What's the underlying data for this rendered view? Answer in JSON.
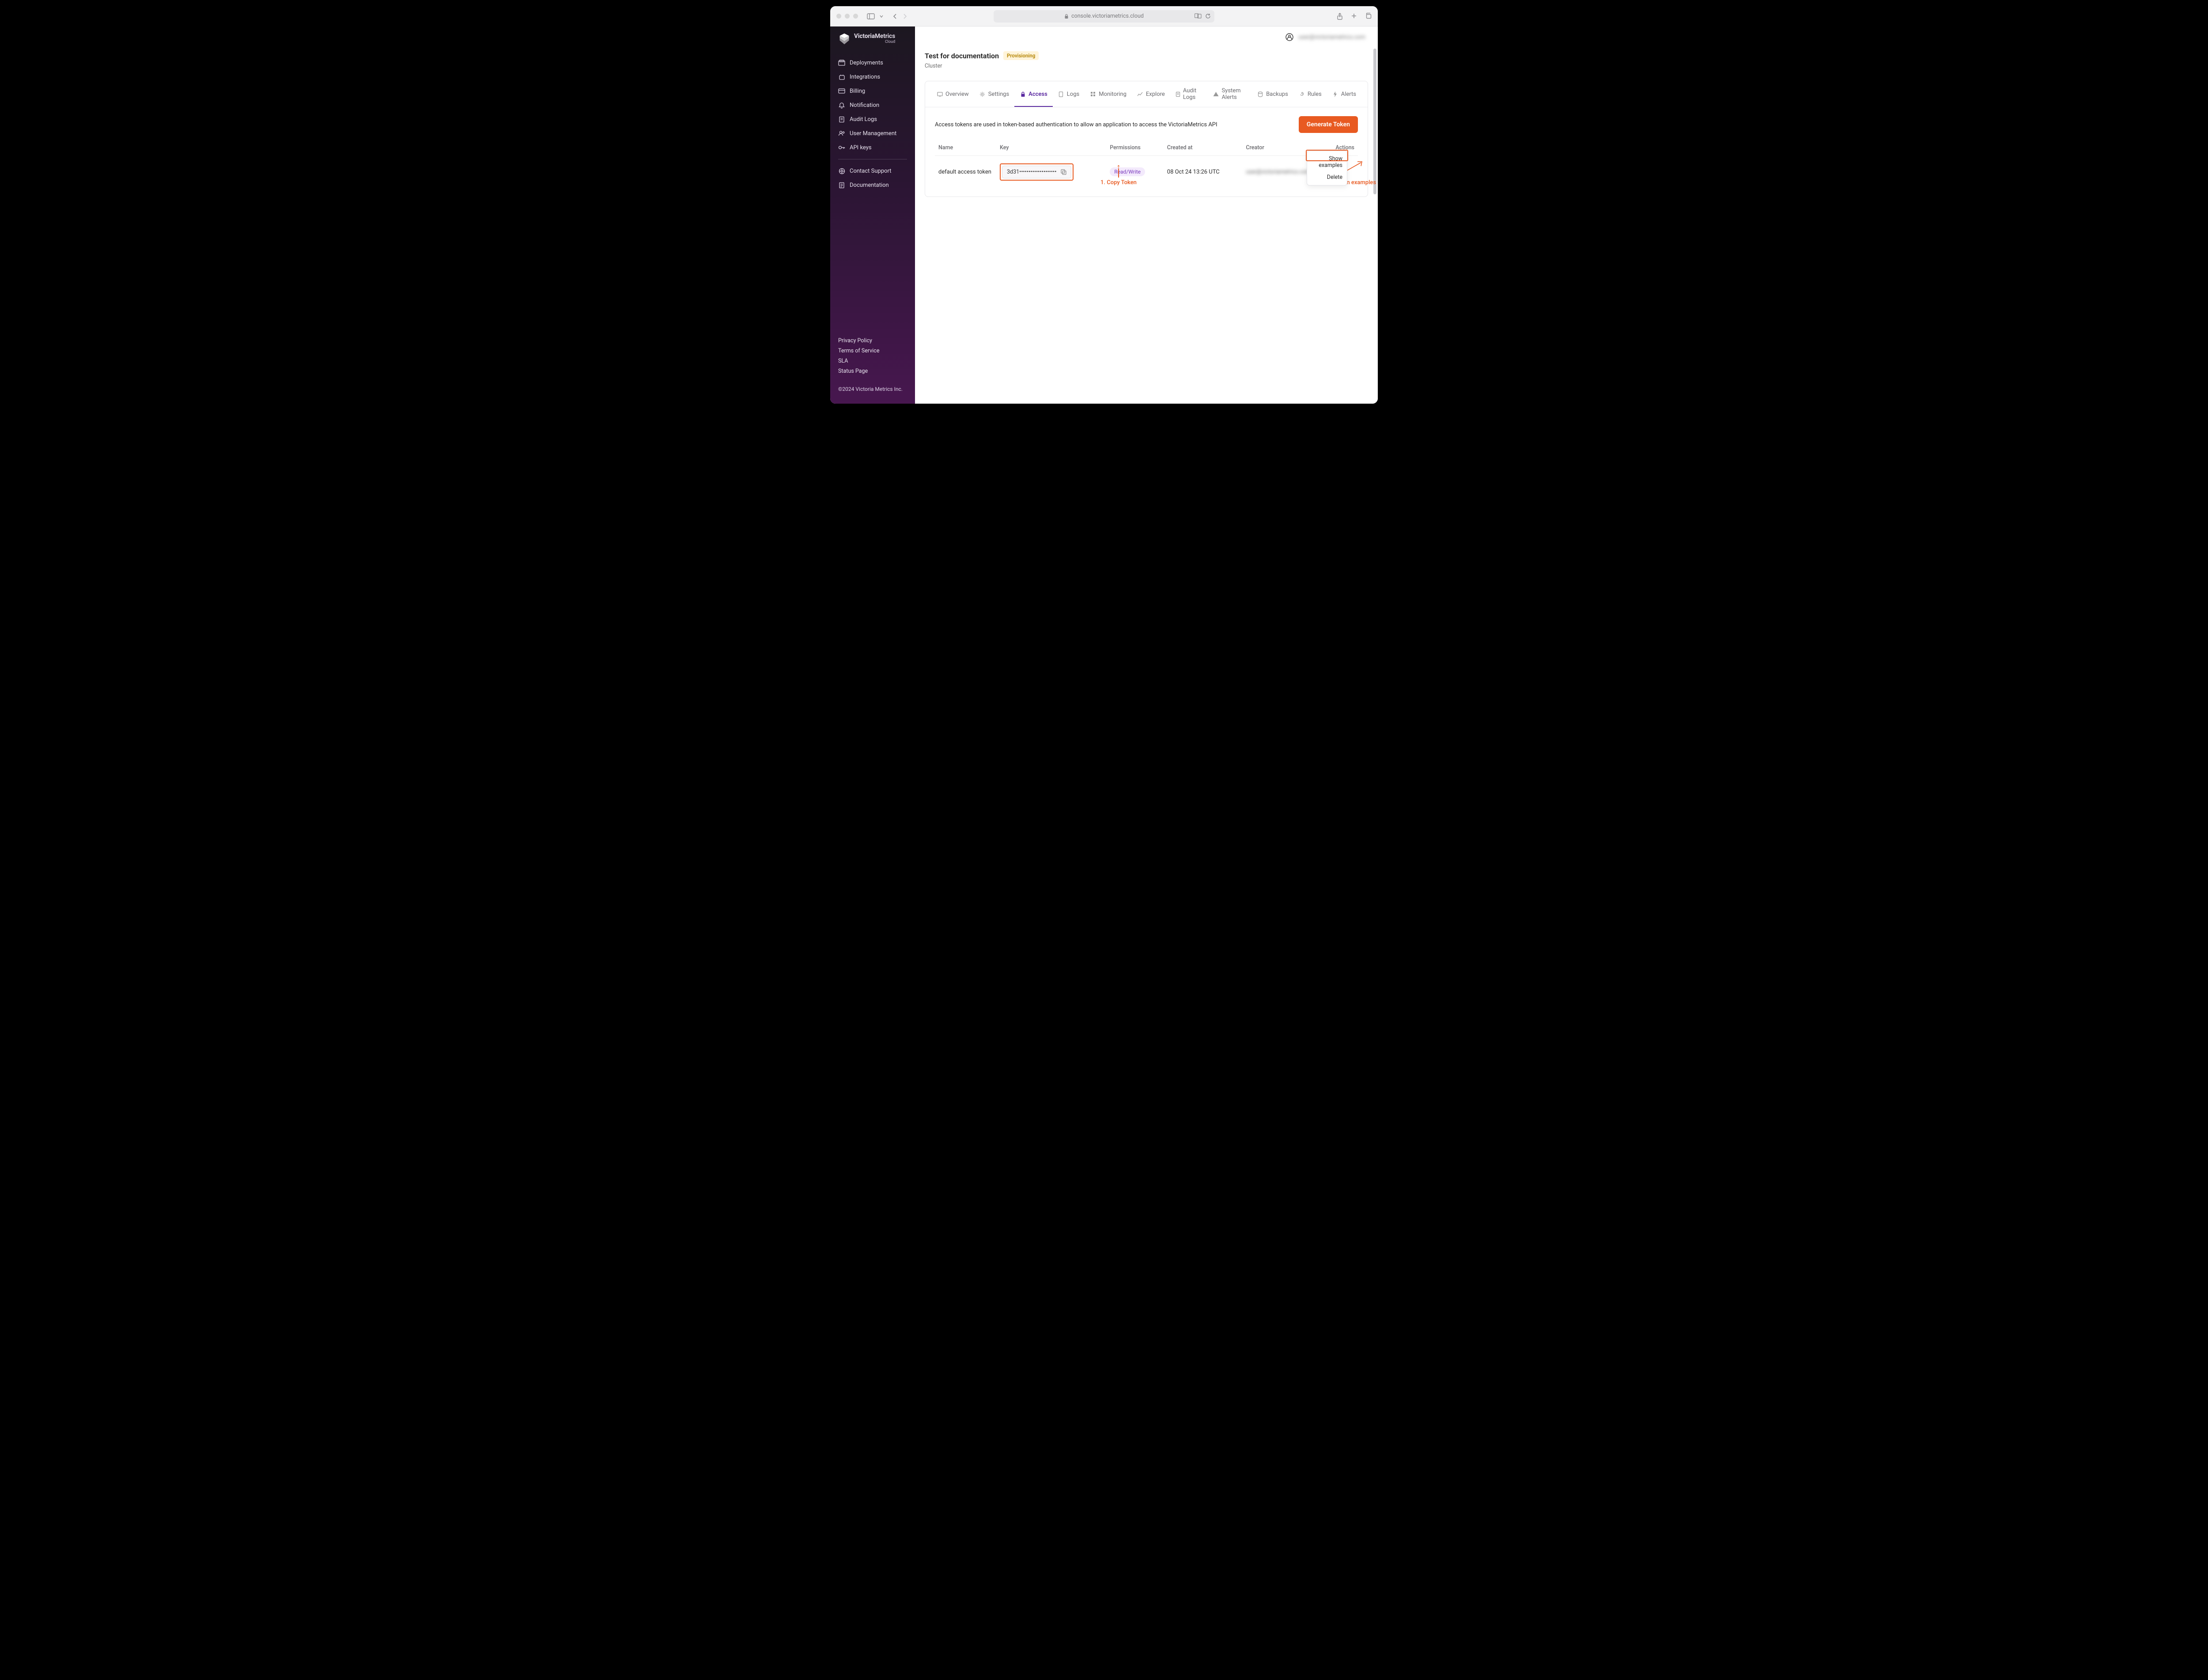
{
  "browser": {
    "url": "console.victoriametrics.cloud"
  },
  "brand": {
    "line1_bold": "Victoria",
    "line1_rest": "Metrics",
    "line2": "Cloud"
  },
  "sidebar": {
    "items": [
      {
        "icon": "deployments-icon",
        "label": "Deployments"
      },
      {
        "icon": "integrations-icon",
        "label": "Integrations"
      },
      {
        "icon": "billing-icon",
        "label": "Billing"
      },
      {
        "icon": "notification-icon",
        "label": "Notification"
      },
      {
        "icon": "auditlogs-icon",
        "label": "Audit Logs"
      },
      {
        "icon": "usermgmt-icon",
        "label": "User Management"
      },
      {
        "icon": "apikeys-icon",
        "label": "API keys"
      }
    ],
    "support": [
      {
        "icon": "support-icon",
        "label": "Contact Support"
      },
      {
        "icon": "docs-icon",
        "label": "Documentation"
      }
    ],
    "footer_links": [
      "Privacy Policy",
      "Terms of Service",
      "SLA",
      "Status Page"
    ],
    "copyright": "©2024 Victoria Metrics Inc."
  },
  "header": {
    "user_email_blurred": "user@victoriametrics.com"
  },
  "page": {
    "title": "Test for documentation",
    "status": "Provisioning",
    "subtitle": "Cluster"
  },
  "tabs": [
    {
      "icon": "overview-icon",
      "label": "Overview"
    },
    {
      "icon": "settings-icon",
      "label": "Settings"
    },
    {
      "icon": "lock-icon",
      "label": "Access",
      "active": true
    },
    {
      "icon": "logs-icon",
      "label": "Logs"
    },
    {
      "icon": "monitoring-icon",
      "label": "Monitoring"
    },
    {
      "icon": "explore-icon",
      "label": "Explore"
    },
    {
      "icon": "auditlogs2-icon",
      "label": "Audit Logs"
    },
    {
      "icon": "alerts-warn-icon",
      "label": "System Alerts"
    },
    {
      "icon": "backups-icon",
      "label": "Backups"
    },
    {
      "icon": "rules-icon",
      "label": "Rules"
    },
    {
      "icon": "bolt-icon",
      "label": "Alerts"
    }
  ],
  "access": {
    "desc": "Access tokens are used in token-based authentication to allow an application to access the VictoriaMetrics API",
    "generate_btn": "Generate Token",
    "columns": {
      "name": "Name",
      "key": "Key",
      "permissions": "Permissions",
      "created": "Created at",
      "creator": "Creator",
      "actions": "Actions"
    },
    "rows": [
      {
        "name": "default access token",
        "key_masked": "3d31••••••••••••••••••••",
        "permission": "Read/Write",
        "created_at": "08 Oct 24 13:26 UTC",
        "creator_blurred": "user@victoriametrics.com"
      }
    ],
    "dropdown": {
      "show": "Show examples",
      "delete": "Delete"
    }
  },
  "annotations": {
    "copy": "1.  Copy Token",
    "open": "2.  Open examples"
  }
}
